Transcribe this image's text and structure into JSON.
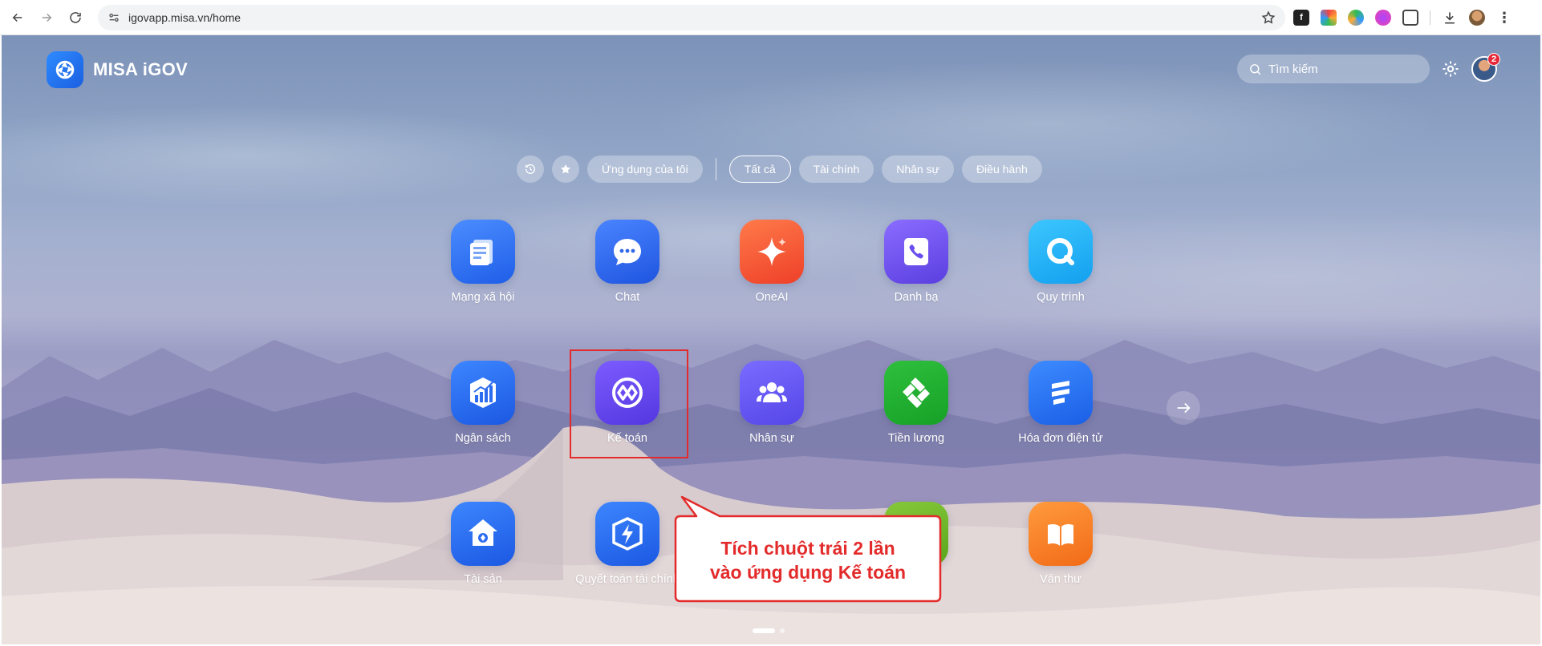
{
  "browser": {
    "url": "igovapp.misa.vn/home"
  },
  "header": {
    "brand": "MISA iGOV",
    "search_placeholder": "Tìm kiếm",
    "notification_count": "2"
  },
  "filters": {
    "my_apps": "Ứng dụng của tôi",
    "tabs": [
      "Tất cả",
      "Tài chính",
      "Nhân sự",
      "Điều hành"
    ],
    "active_tab": "Tất cả"
  },
  "apps": {
    "row1": [
      "Mạng xã hội",
      "Chat",
      "OneAI",
      "Danh bạ",
      "Quy trình"
    ],
    "row2": [
      "Ngân sách",
      "Kế toán",
      "Nhân sự",
      "Tiền lương",
      "Hóa đơn điện tử"
    ],
    "row3": [
      "Tài sản",
      "Quyết toán tài chính",
      "Văn thư"
    ]
  },
  "callout": {
    "line1": "Tích chuột trái 2 lần",
    "line2": "vào ứng dụng Kế toán",
    "color": "#e32b2b"
  },
  "icons": {
    "back": "arrow-left-icon",
    "forward": "arrow-right-icon",
    "reload": "reload-icon",
    "history": "history-icon",
    "favorites": "star-icon",
    "settings": "gear-icon"
  }
}
